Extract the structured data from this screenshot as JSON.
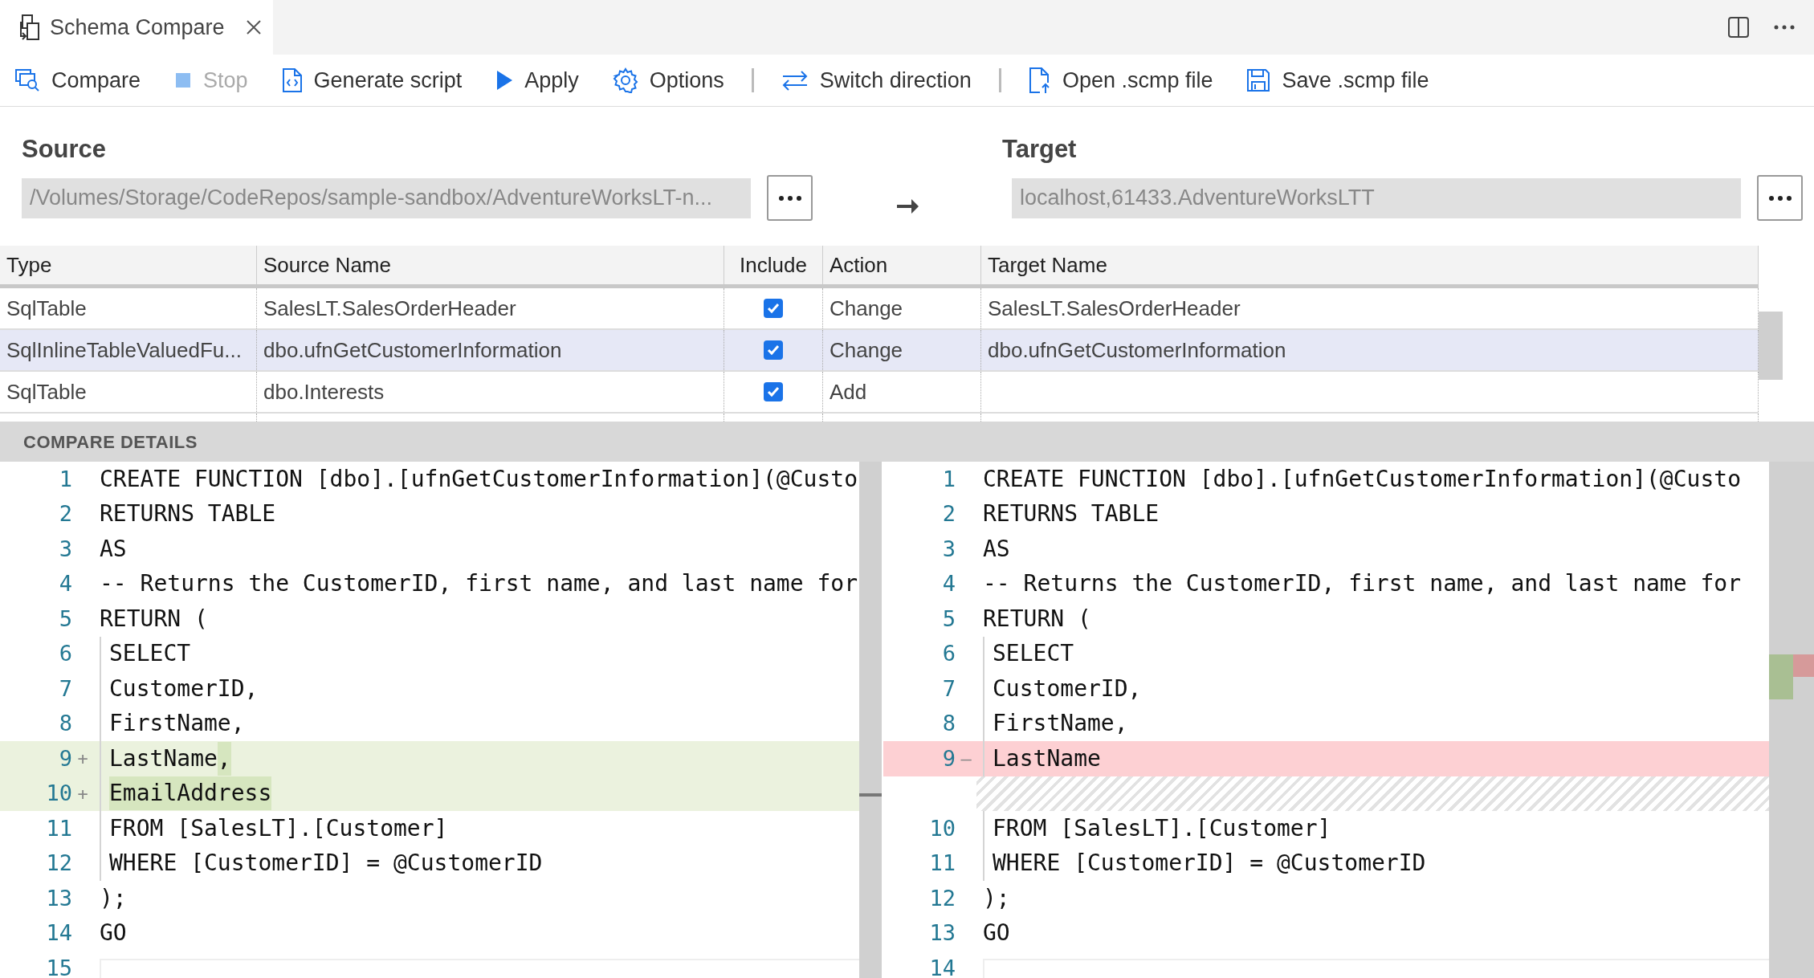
{
  "tab": {
    "title": "Schema Compare",
    "selected": true
  },
  "toolbar": [
    {
      "kind": "button",
      "label": "Compare",
      "disabled": false
    },
    {
      "kind": "button",
      "label": "Stop",
      "disabled": true
    },
    {
      "kind": "button",
      "label": "Generate script",
      "disabled": false
    },
    {
      "kind": "button",
      "label": "Apply",
      "disabled": false
    },
    {
      "kind": "button",
      "label": "Options",
      "disabled": false
    },
    {
      "kind": "separator"
    },
    {
      "kind": "button",
      "label": "Switch direction",
      "disabled": false
    },
    {
      "kind": "separator"
    },
    {
      "kind": "button",
      "label": "Open .scmp file",
      "disabled": false
    },
    {
      "kind": "button",
      "label": "Save .scmp file",
      "disabled": false
    }
  ],
  "source": {
    "label": "Source",
    "value": "/Volumes/Storage/CodeRepos/sample-sandbox/AdventureWorksLT-n..."
  },
  "target": {
    "label": "Target",
    "value": "localhost,61433.AdventureWorksLTT"
  },
  "table": {
    "columns": [
      "Type",
      "Source Name",
      "Include",
      "Action",
      "Target Name"
    ],
    "rows": [
      {
        "type": "SqlTable",
        "source_name": "SalesLT.SalesOrderHeader",
        "include": true,
        "action": "Change",
        "target_name": "SalesLT.SalesOrderHeader",
        "selected": false
      },
      {
        "type": "SqlInlineTableValuedFu...",
        "source_name": "dbo.ufnGetCustomerInformation",
        "include": true,
        "action": "Change",
        "target_name": "dbo.ufnGetCustomerInformation",
        "selected": true
      },
      {
        "type": "SqlTable",
        "source_name": "dbo.Interests",
        "include": true,
        "action": "Add",
        "target_name": "",
        "selected": false
      }
    ]
  },
  "details_title": "COMPARE DETAILS",
  "source_editor": [
    {
      "kind": "normal",
      "number": "1",
      "text": "CREATE FUNCTION [dbo].[ufnGetCustomerInformation](@Custo",
      "indented": false
    },
    {
      "kind": "normal",
      "number": "2",
      "text": "RETURNS TABLE",
      "indented": false
    },
    {
      "kind": "normal",
      "number": "3",
      "text": "AS",
      "indented": false
    },
    {
      "kind": "normal",
      "number": "4",
      "text": "-- Returns the CustomerID, first name, and last name for",
      "indented": false
    },
    {
      "kind": "normal",
      "number": "5",
      "text": "RETURN (",
      "indented": false
    },
    {
      "kind": "normal",
      "number": "6",
      "text": "SELECT",
      "indented": true
    },
    {
      "kind": "normal",
      "number": "7",
      "text": "CustomerID,",
      "indented": true
    },
    {
      "kind": "normal",
      "number": "8",
      "text": "FirstName,",
      "indented": true
    },
    {
      "kind": "added",
      "number": "9",
      "marker": "+",
      "segments": [
        {
          "text": "LastName",
          "changed": false
        },
        {
          "text": ",",
          "changed": true
        }
      ],
      "indented": true
    },
    {
      "kind": "added",
      "number": "10",
      "marker": "+",
      "segments": [
        {
          "text": "EmailAddress",
          "changed": true
        }
      ],
      "indented": true
    },
    {
      "kind": "normal",
      "number": "11",
      "text": "FROM [SalesLT].[Customer]",
      "indented": true
    },
    {
      "kind": "normal",
      "number": "12",
      "text": "WHERE [CustomerID] = @CustomerID",
      "indented": true
    },
    {
      "kind": "normal",
      "number": "13",
      "text": ");",
      "indented": false
    },
    {
      "kind": "normal",
      "number": "14",
      "text": "GO",
      "indented": false
    },
    {
      "kind": "normal",
      "number": "15"
    }
  ],
  "target_editor": [
    {
      "kind": "normal",
      "number": "1",
      "text": "CREATE FUNCTION [dbo].[ufnGetCustomerInformation](@Custo",
      "indented": false
    },
    {
      "kind": "normal",
      "number": "2",
      "text": "RETURNS TABLE",
      "indented": false
    },
    {
      "kind": "normal",
      "number": "3",
      "text": "AS",
      "indented": false
    },
    {
      "kind": "normal",
      "number": "4",
      "text": "-- Returns the CustomerID, first name, and last name for",
      "indented": false
    },
    {
      "kind": "normal",
      "number": "5",
      "text": "RETURN (",
      "indented": false
    },
    {
      "kind": "normal",
      "number": "6",
      "text": "SELECT",
      "indented": true
    },
    {
      "kind": "normal",
      "number": "7",
      "text": "CustomerID,",
      "indented": true
    },
    {
      "kind": "normal",
      "number": "8",
      "text": "FirstName,",
      "indented": true
    },
    {
      "kind": "removed",
      "number": "9",
      "marker": "—",
      "segments": [
        {
          "text": "LastName",
          "changed": false
        }
      ],
      "indented": true
    },
    {
      "kind": "filler"
    },
    {
      "kind": "normal",
      "number": "10",
      "text": "FROM [SalesLT].[Customer]",
      "indented": true
    },
    {
      "kind": "normal",
      "number": "11",
      "text": "WHERE [CustomerID] = @CustomerID",
      "indented": true
    },
    {
      "kind": "normal",
      "number": "12",
      "text": ");",
      "indented": false
    },
    {
      "kind": "normal",
      "number": "13",
      "text": "GO",
      "indented": false
    },
    {
      "kind": "normal",
      "number": "14"
    }
  ]
}
